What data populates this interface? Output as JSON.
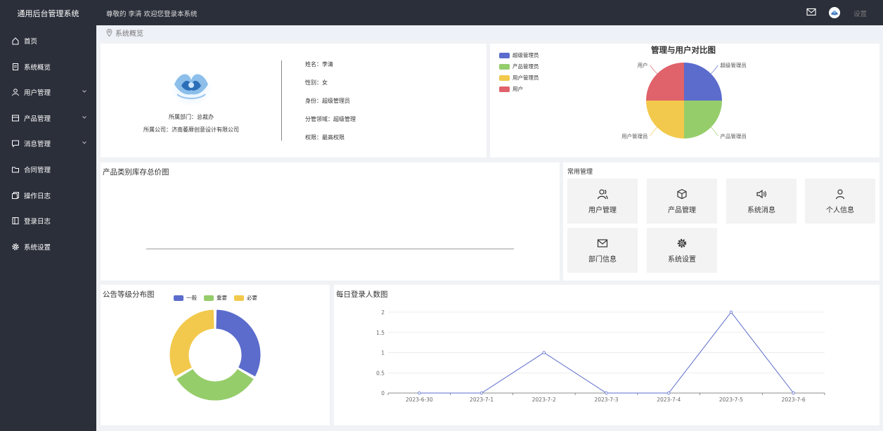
{
  "app": {
    "title": "通用后台管理系统"
  },
  "sidebar": {
    "items": [
      {
        "label": "首页",
        "icon": "home-icon",
        "expandable": false
      },
      {
        "label": "系统概览",
        "icon": "document-icon",
        "expandable": false
      },
      {
        "label": "用户管理",
        "icon": "user-icon",
        "expandable": true
      },
      {
        "label": "产品管理",
        "icon": "box-icon",
        "expandable": true
      },
      {
        "label": "消息管理",
        "icon": "message-icon",
        "expandable": true
      },
      {
        "label": "合同管理",
        "icon": "folder-icon",
        "expandable": false
      },
      {
        "label": "操作日志",
        "icon": "log-icon",
        "expandable": false
      },
      {
        "label": "登录日志",
        "icon": "book-icon",
        "expandable": false
      },
      {
        "label": "系统设置",
        "icon": "gear-icon",
        "expandable": false
      }
    ]
  },
  "header": {
    "welcome": "尊敬的 李清 欢迎您登录本系统",
    "settings_label": "设置"
  },
  "breadcrumb": {
    "label": "系统概览"
  },
  "profile": {
    "department": "所属部门：总裁办",
    "company": "所属公司：济南萎靡创意设计有限公司",
    "name": "姓名：李清",
    "gender": "性别：女",
    "identity": "身份：超级管理员",
    "domain": "分管领域：超级管理",
    "permission": "权限：最高权限"
  },
  "quick": {
    "title": "常用管理",
    "tiles": [
      {
        "label": "用户管理",
        "icon": "users-icon"
      },
      {
        "label": "产品管理",
        "icon": "cube-icon"
      },
      {
        "label": "系统消息",
        "icon": "speaker-icon"
      },
      {
        "label": "个人信息",
        "icon": "person-icon"
      },
      {
        "label": "部门信息",
        "icon": "envelope-icon"
      },
      {
        "label": "系统设置",
        "icon": "gear-icon"
      }
    ]
  },
  "colors": {
    "blue": "#5b6ccc",
    "green": "#96cd6b",
    "yellow": "#f2c94c",
    "red": "#e0626a",
    "sidebar": "#2b2f3a"
  },
  "chart_data": [
    {
      "type": "pie",
      "title": "管理与用户对比图",
      "legend": [
        "超级管理员",
        "产品管理员",
        "用户管理员",
        "用户"
      ],
      "legend_position": "top-left",
      "slices": [
        {
          "name": "超级管理员",
          "value": 1
        },
        {
          "name": "产品管理员",
          "value": 1
        },
        {
          "name": "用户管理员",
          "value": 1
        },
        {
          "name": "用户",
          "value": 1
        }
      ]
    },
    {
      "type": "bar",
      "title": "产品类别库存总价图",
      "categories": [],
      "values": []
    },
    {
      "type": "pie",
      "subtype": "donut",
      "title": "公告等级分布图",
      "legend": [
        "一般",
        "重要",
        "必要"
      ],
      "legend_position": "top-center",
      "slices": [
        {
          "name": "一般",
          "value": 1
        },
        {
          "name": "重要",
          "value": 1
        },
        {
          "name": "必要",
          "value": 1
        }
      ]
    },
    {
      "type": "line",
      "title": "每日登录人数图",
      "x": [
        "2023-6-30",
        "2023-7-1",
        "2023-7-2",
        "2023-7-3",
        "2023-7-4",
        "2023-7-5",
        "2023-7-6"
      ],
      "y": [
        0,
        0,
        1,
        0,
        0,
        2,
        0
      ],
      "y_ticks": [
        "0",
        "0.5",
        "1",
        "1.5",
        "2"
      ],
      "ylim": [
        0,
        2
      ],
      "grid": true
    }
  ]
}
